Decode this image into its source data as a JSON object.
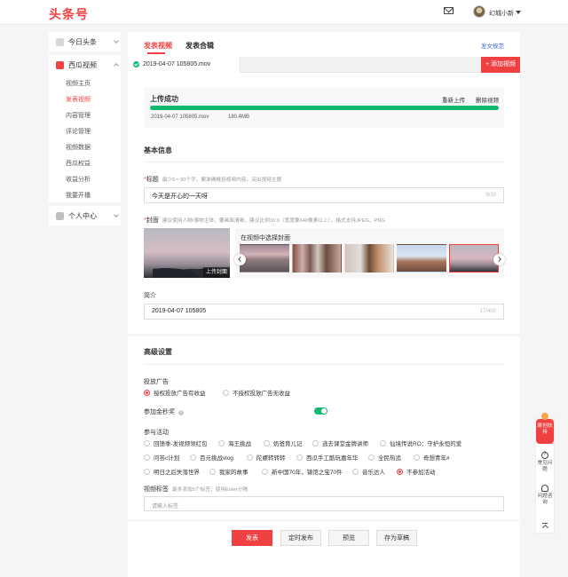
{
  "header": {
    "logo": "头条号",
    "username": "幻城小新"
  },
  "sidebar": {
    "top": {
      "label": "今日头条"
    },
    "main": {
      "label": "西瓜视频",
      "items": [
        "视频主页",
        "发表视频",
        "内容管理",
        "评论管理",
        "视频数据",
        "西瓜权益",
        "收益分析",
        "我要开播"
      ],
      "active_index": 1
    },
    "bottom": {
      "label": "个人中心"
    }
  },
  "editor": {
    "tabs": [
      "发表视频",
      "发表合辑"
    ],
    "rules_link": "发文规范",
    "file_tab": "2019-04-07 105805.mov",
    "add_video": "+ 添加视频",
    "upload": {
      "status": "上传成功",
      "reupload": "重新上传",
      "delete": "删除视频",
      "file_name": "2019-04-07 105805.mov",
      "file_size": "180.4MB",
      "progress": 1
    },
    "basic_info": "基本信息",
    "title": {
      "label": "标题",
      "hint": "最少5～30个字，要准确概括视频内容，突出视频主题",
      "value": "今天是开心的一天呀",
      "counter": "9/30"
    },
    "cover": {
      "label": "封面",
      "hint": "建议使用人物/事物主体；要画面清晰，建议比例16:9（宽度要640像素以上），格式支持JPEG、PNG",
      "main_label": "上传封面",
      "frames_title": "在视频中选择封面",
      "selected_index": 4
    },
    "intro": {
      "label": "简介",
      "value": "2019-04-07 105805",
      "counter": "17/400"
    },
    "advanced": "高级设置",
    "ads": {
      "label": "投放广告",
      "options": [
        "授权投放广告有收益",
        "不授权投放广告无收益"
      ],
      "selected": 0
    },
    "gold_video": {
      "label": "参加金秒奖",
      "help": "?",
      "enabled": true
    },
    "activities": {
      "label": "参与活动",
      "options": [
        "回馈季-发视频领红包",
        "海王挑战",
        "奶爸育儿记",
        "逃去课堂金牌讲师",
        "仙境传说RO：守护永恒的爱",
        "问答c计划",
        "百元挑战vlog",
        "陀螺转转转",
        "西瓜手工酷玩嘉年华",
        "全民热追",
        "奇想青年#",
        "明日之后失落世界",
        "我家的故事",
        "新中国70年，镇馆之宝70件",
        "音乐达人",
        "不参加活动"
      ],
      "selected": 15
    },
    "tags": {
      "label": "视频标签",
      "hint": "最多添加5个标签，使用Enter分隔",
      "placeholder": "请输入标签"
    },
    "actions": [
      "发表",
      "定时发布",
      "预览",
      "存为草稿"
    ]
  },
  "float_panel": {
    "promo": "原创扶持",
    "faq": "常见问题",
    "consult": "问题咨询"
  },
  "colors": {
    "accent": "#f04142",
    "success": "#10b76e",
    "link": "#3f6ad8"
  }
}
